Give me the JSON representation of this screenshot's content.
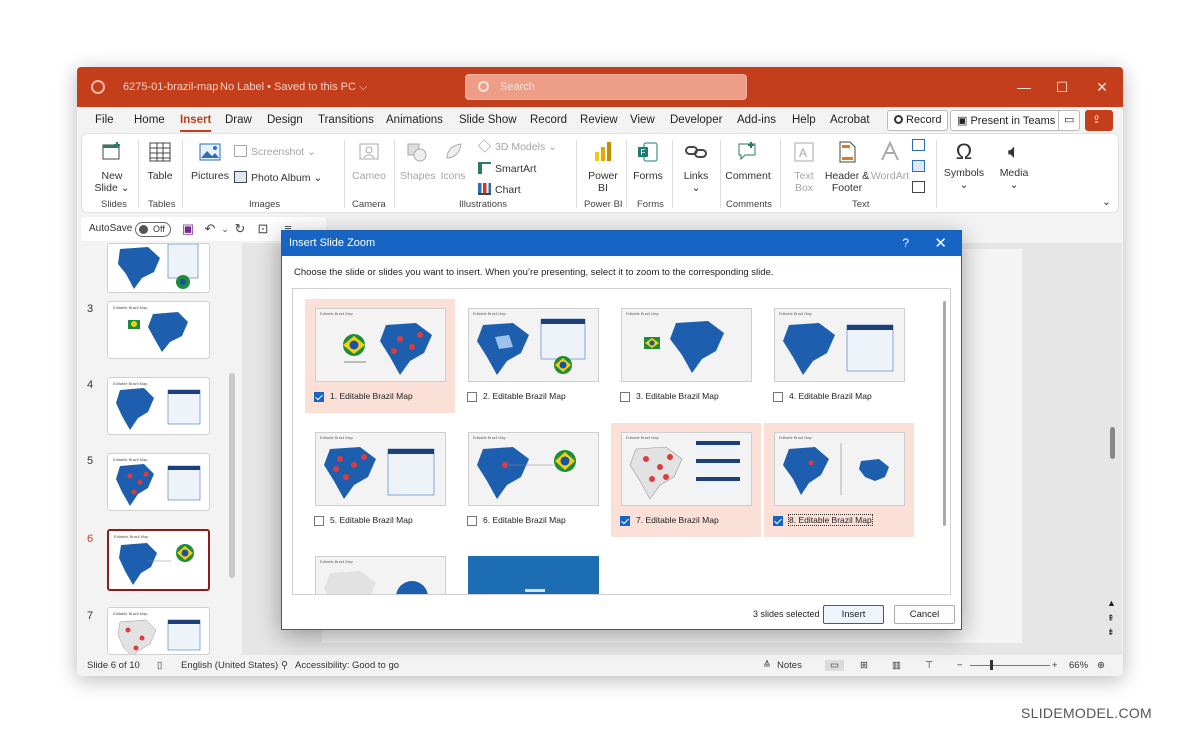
{
  "window": {
    "doc_title": "6275-01-brazil-map",
    "sensitivity": "No Label • Saved to this PC ⌵",
    "search_placeholder": "Search"
  },
  "menu": {
    "items": [
      "File",
      "Home",
      "Insert",
      "Draw",
      "Design",
      "Transitions",
      "Animations",
      "Slide Show",
      "Record",
      "Review",
      "View",
      "Developer",
      "Add-ins",
      "Help",
      "Acrobat"
    ],
    "active": "Insert",
    "record_btn": "Record",
    "present_btn": "Present in Teams"
  },
  "ribbon": {
    "new_slide": "New Slide ⌄",
    "table": "Table",
    "pictures": "Pictures",
    "screenshot": "Screenshot ⌄",
    "photo_album": "Photo Album",
    "cameo": "Cameo",
    "shapes": "Shapes",
    "icons": "Icons",
    "models_3d": "3D Models",
    "smartart": "SmartArt",
    "chart": "Chart",
    "power_bi": "Power BI",
    "forms": "Forms",
    "links": "Links",
    "comment": "Comment",
    "text_box": "Text Box",
    "header_footer": "Header & Footer",
    "wordart": "WordArt",
    "symbols": "Symbols",
    "media": "Media",
    "groups": [
      "Slides",
      "Tables",
      "Images",
      "Camera",
      "Illustrations",
      "Power BI",
      "Forms",
      "Comments",
      "Text"
    ]
  },
  "qat": {
    "autosave": "AutoSave",
    "toggle": "Off"
  },
  "thumbnails": [
    {
      "num": "",
      "title": ""
    },
    {
      "num": "3",
      "title": "Editable Brazil Map"
    },
    {
      "num": "4",
      "title": "Editable Brazil Map"
    },
    {
      "num": "5",
      "title": "Editable Brazil Map"
    },
    {
      "num": "6",
      "title": "Editable Brazil Map"
    },
    {
      "num": "7",
      "title": "Editable Brazil Map"
    }
  ],
  "status": {
    "slide": "Slide 6 of 10",
    "language": "English (United States)",
    "accessibility": "Accessibility: Good to go",
    "notes": "Notes",
    "zoom": "66%"
  },
  "dialog": {
    "title": "Insert Slide Zoom",
    "help": "?",
    "close": "✕",
    "instructions": "Choose the slide or slides you want to insert. When you’re presenting, select it to zoom to the corresponding slide.",
    "tiles": [
      {
        "caption": "1. Editable Brazil Map",
        "checked": true
      },
      {
        "caption": "2. Editable Brazil Map",
        "checked": false
      },
      {
        "caption": "3. Editable Brazil Map",
        "checked": false
      },
      {
        "caption": "4. Editable Brazil Map",
        "checked": false
      },
      {
        "caption": "5. Editable Brazil Map",
        "checked": false
      },
      {
        "caption": "6. Editable Brazil Map",
        "checked": false
      },
      {
        "caption": "7. Editable Brazil Map",
        "checked": true
      },
      {
        "caption": "8. Editable Brazil Map",
        "checked": true
      }
    ],
    "mini_title": "Editable Brazil Map",
    "selected_count": "3 slides selected",
    "insert_btn": "Insert",
    "cancel_btn": "Cancel"
  },
  "watermark": "SLIDEMODEL.COM",
  "colors": {
    "accent": "#c43e1c",
    "dialog_blue": "#1664c4",
    "map_blue": "#1d5fae",
    "selection_tint": "#fbe0d8"
  }
}
